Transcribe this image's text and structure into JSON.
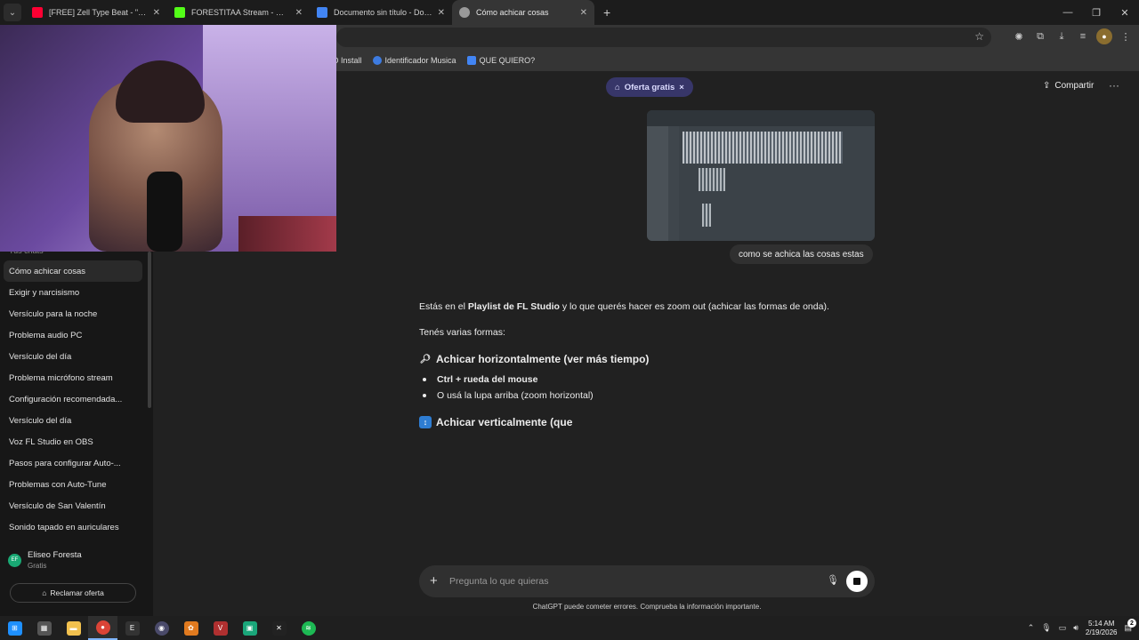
{
  "browser": {
    "tabs": [
      {
        "label": "[FREE] Zell Type Beat - \"NATUR",
        "color": "#ff0033",
        "active": false
      },
      {
        "label": "FORESTITAA Stream - Watch Liv",
        "color": "#53fc18",
        "active": false
      },
      {
        "label": "Documento sin título - Docume",
        "color": "#4285f4",
        "active": false
      },
      {
        "label": "Cómo achicar cosas",
        "color": "#9a9a9a",
        "active": true
      }
    ],
    "newtab": "+",
    "window_controls": [
      "—",
      "❐",
      "✕"
    ],
    "bookmarks": [
      {
        "label": "D Install",
        "color": "#444444"
      },
      {
        "label": "Identificador Musica",
        "color": "#3d7be0"
      },
      {
        "label": "QUE QUIERO?",
        "color": "#4285f4"
      }
    ]
  },
  "sidebar": {
    "section_label": "Tus chats",
    "items": [
      "Cómo achicar cosas",
      "Exigir y narcisismo",
      "Versículo para la noche",
      "Problema audio PC",
      "Versículo del día",
      "Problema micrófono stream",
      "Configuración recomendada...",
      "Versículo del día",
      "Voz FL Studio en OBS",
      "Pasos para configurar Auto-...",
      "Problemas con Auto-Tune",
      "Versículo de San Valentín",
      "Sonido tapado en auriculares"
    ],
    "user": {
      "initials": "EF",
      "name": "Eliseo Foresta",
      "plan": "Gratis"
    },
    "claim_label": "Reclamar oferta"
  },
  "header": {
    "offer_label": "Oferta gratis",
    "offer_close": "×",
    "share_label": "Compartir",
    "more": "···"
  },
  "conversation": {
    "user_message": "como se achica las cosas estas",
    "answer": {
      "intro_pre": "Estás en el ",
      "intro_bold": "Playlist de FL Studio",
      "intro_post": " y lo que querés hacer es zoom out (achicar las formas de onda).",
      "line2": "Tenés varias formas:",
      "h1": "Achicar horizontalmente (ver más tiempo)",
      "bullet1": "Ctrl + rueda del mouse",
      "bullet2": "O usá la lupa arriba (zoom horizontal)",
      "h2": "Achicar verticalmente (que"
    }
  },
  "composer": {
    "placeholder": "Pregunta lo que quieras",
    "disclaimer": "ChatGPT puede cometer errores. Comprueba la información importante."
  },
  "taskbar": {
    "apps": [
      {
        "name": "start",
        "color": "#1e90ff",
        "glyph": "⊞"
      },
      {
        "name": "files",
        "color": "#555555",
        "glyph": "▦"
      },
      {
        "name": "explorer",
        "color": "#f2c14e",
        "glyph": "▬"
      },
      {
        "name": "chrome",
        "color": "#db4437",
        "glyph": "●"
      },
      {
        "name": "epic",
        "color": "#333333",
        "glyph": "EPIC"
      },
      {
        "name": "obs",
        "color": "#4a4a6a",
        "glyph": "◉"
      },
      {
        "name": "fl-studio",
        "color": "#e07a1f",
        "glyph": "✿"
      },
      {
        "name": "voicemeeter",
        "color": "#b03030",
        "glyph": "VM"
      },
      {
        "name": "app-green",
        "color": "#1aa67a",
        "glyph": "▣"
      },
      {
        "name": "capcut",
        "color": "#222222",
        "glyph": "✕"
      },
      {
        "name": "spotify",
        "color": "#1db954",
        "glyph": "≋"
      }
    ],
    "time": "5:14 AM",
    "date": "2/19/2026",
    "notifications": "2"
  }
}
